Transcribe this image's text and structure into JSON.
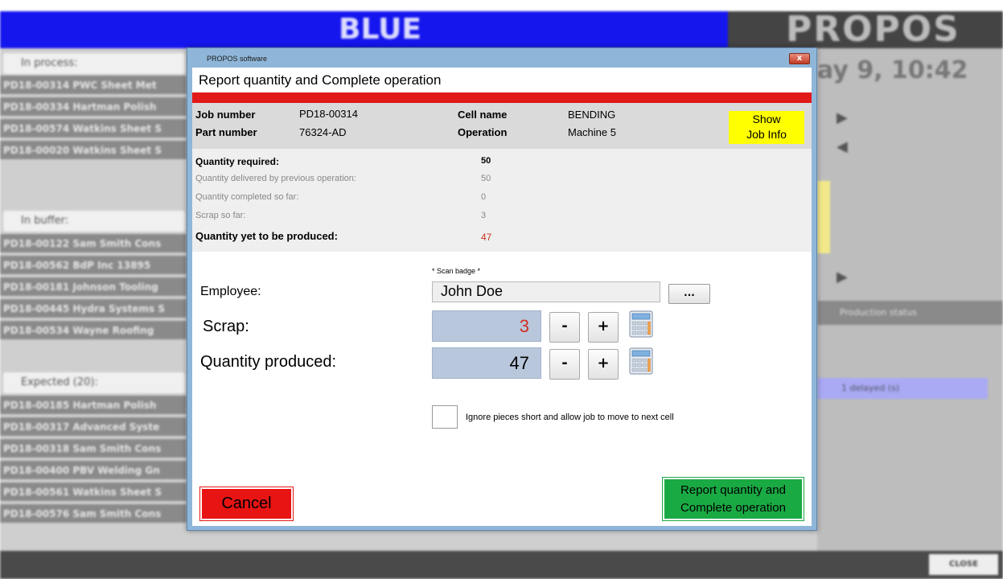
{
  "background": {
    "cell_banner": "BLUE",
    "brand": "PROPOS",
    "datetime": "ay 9, 10:42",
    "in_process_label": "In process:",
    "in_process_rows": [
      "PD18-00314  PWC Sheet Met",
      "PD18-00334  Hartman Polish",
      "PD18-00574  Watkins Sheet S",
      "PD18-00020  Watkins Sheet S"
    ],
    "in_buffer_label": "In buffer:",
    "in_buffer_rows": [
      "PD18-00122  Sam Smith Cons",
      "PD18-00562  BdP Inc 13895",
      "PD18-00181  Johnson Tooling",
      "PD18-00445  Hydra Systems S",
      "PD18-00534  Wayne Roofing"
    ],
    "expected_label": "Expected (20):",
    "expected_rows": [
      "PD18-00185  Hartman Polish",
      "PD18-00317  Advanced Syste",
      "PD18-00318  Sam Smith Cons",
      "PD18-00400  PBV Welding Gn",
      "PD18-00561  Watkins Sheet S",
      "PD18-00576  Sam Smith Cons"
    ],
    "status_panel_label": "Production status",
    "purple_label": "1 delayed (s)",
    "close_label": "CLOSE"
  },
  "dialog": {
    "app_title": "PROPOS software",
    "close_icon": "x",
    "heading": "Report quantity and Complete operation",
    "job": {
      "job_number_label": "Job number",
      "job_number": "PD18-00314",
      "part_number_label": "Part number",
      "part_number": "76324-AD",
      "cell_name_label": "Cell name",
      "cell_name": "BENDING",
      "operation_label": "Operation",
      "operation": "Machine 5",
      "show_job_info_line1": "Show",
      "show_job_info_line2": "Job Info"
    },
    "quantities": {
      "required_label": "Quantity required:",
      "required": "50",
      "delivered_label": "Quantity delivered by previous operation:",
      "delivered": "50",
      "completed_label": "Quantity completed so far:",
      "completed": "0",
      "scrap_so_far_label": "Scrap so far:",
      "scrap_so_far": "3",
      "yet_label": "Quantity yet to be produced:",
      "yet": "47"
    },
    "form": {
      "scan_hint": "* Scan badge *",
      "employee_label": "Employee:",
      "employee_value": "John Doe",
      "browse_label": "...",
      "scrap_label": "Scrap:",
      "scrap_value": "3",
      "qty_label": "Quantity produced:",
      "qty_value": "47",
      "minus": "-",
      "plus": "+",
      "ignore_label": "Ignore pieces short and allow job to move to next cell"
    },
    "buttons": {
      "cancel": "Cancel",
      "report_line1": "Report quantity and",
      "report_line2": "Complete operation"
    }
  },
  "colors": {
    "banner_blue": "#1515ee",
    "red_bar": "#e11919",
    "show_info_yellow": "#ffff00",
    "cancel_red": "#e81414",
    "report_green": "#1aaa44",
    "number_box": "#b8c7dc",
    "alert_value": "#c8361e"
  }
}
